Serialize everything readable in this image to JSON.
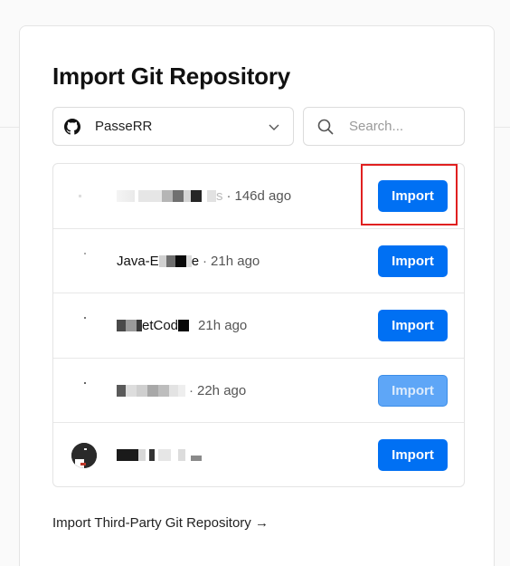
{
  "title": "Import Git Repository",
  "owner_select": {
    "value": "PasseRR",
    "icon": "github-icon"
  },
  "search": {
    "placeholder": "Search..."
  },
  "repos": [
    {
      "name_visible": "s",
      "sep": "·",
      "ago": "146d ago",
      "button": "Import",
      "disabled": false
    },
    {
      "name_visible_prefix": "Java-E",
      "name_visible_suffix": "e",
      "sep": "·",
      "ago": "21h ago",
      "button": "Import",
      "disabled": false
    },
    {
      "name_visible": "etCod",
      "ago": "21h ago",
      "button": "Import",
      "disabled": false
    },
    {
      "sep": "·",
      "ago": "22h ago",
      "button": "Import",
      "disabled": true
    },
    {
      "button": "Import",
      "disabled": false
    }
  ],
  "third_party_link": "Import Third-Party Git Repository →",
  "colors": {
    "primary": "#0070f3",
    "primary_disabled": "#5ea6f7",
    "highlight": "#e02020"
  }
}
